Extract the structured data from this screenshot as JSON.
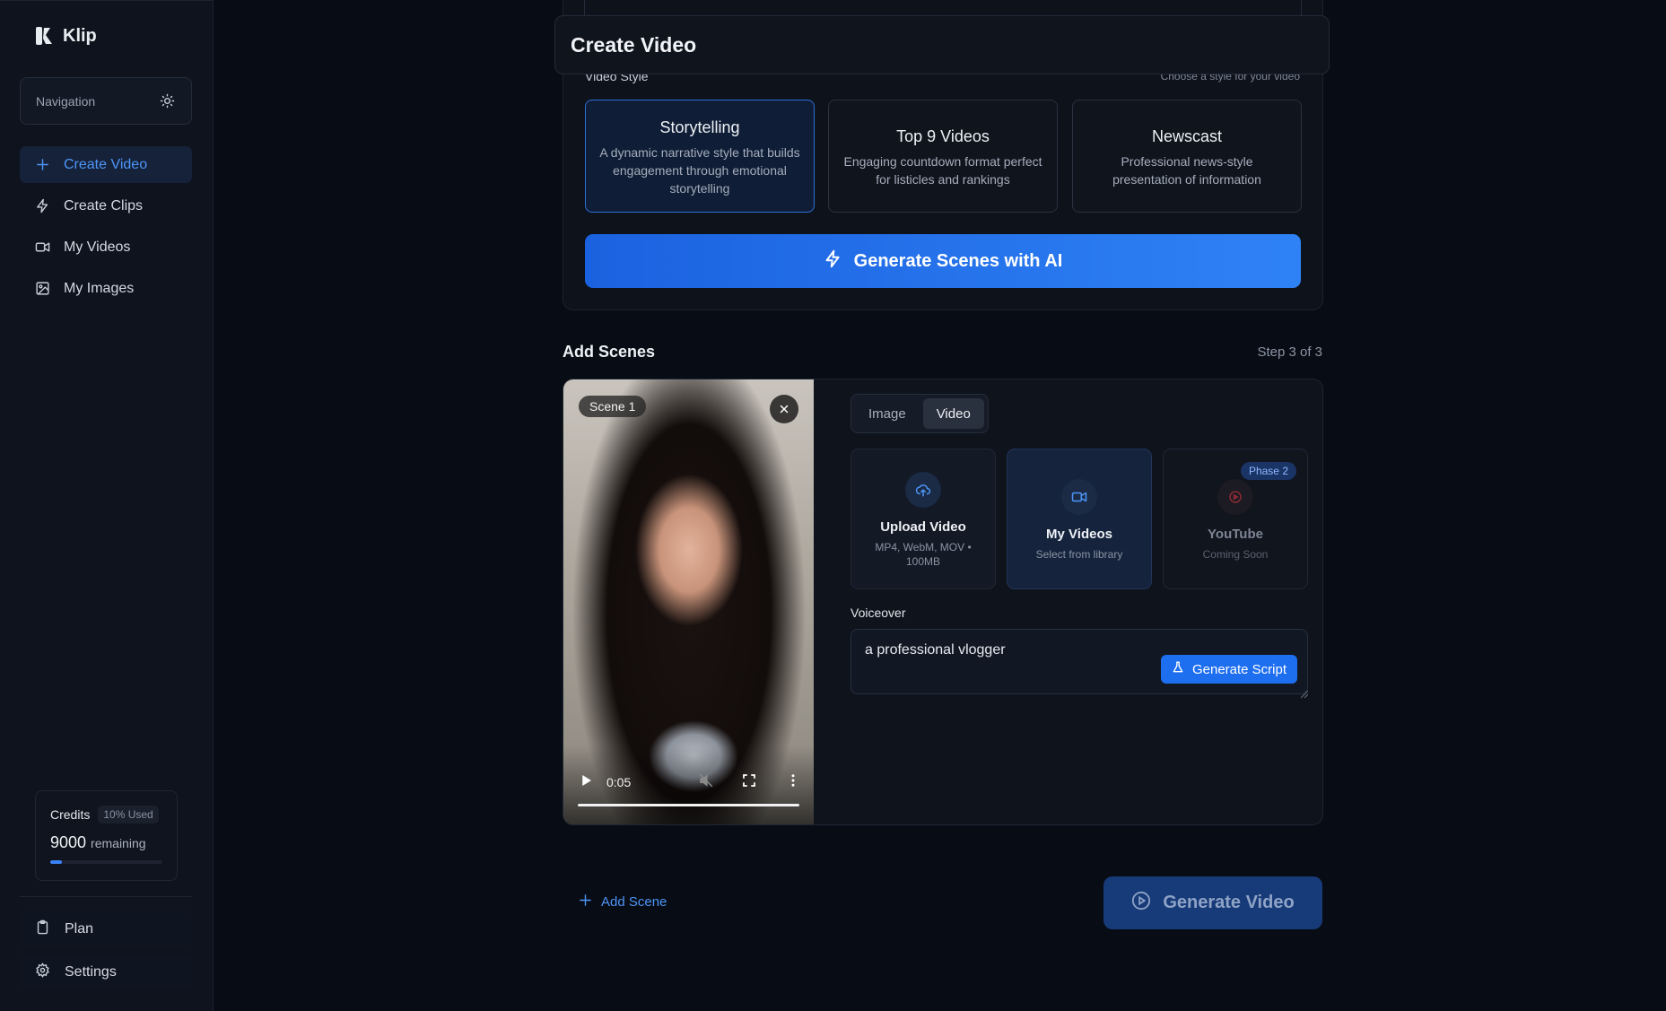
{
  "app": {
    "name": "Klip"
  },
  "sidebar": {
    "navigation_label": "Navigation",
    "items": [
      {
        "label": "Create Video",
        "icon": "plus-icon",
        "active": true
      },
      {
        "label": "Create Clips",
        "icon": "lightning-icon",
        "active": false
      },
      {
        "label": "My Videos",
        "icon": "video-camera-icon",
        "active": false
      },
      {
        "label": "My Images",
        "icon": "image-icon",
        "active": false
      }
    ],
    "credits": {
      "title": "Credits",
      "badge": "10% Used",
      "amount": "9000",
      "remaining_label": "remaining",
      "used_fraction": 0.1
    },
    "bottom": {
      "plan": "Plan",
      "settings": "Settings"
    }
  },
  "header": {
    "title": "Create Video"
  },
  "video_style": {
    "label": "Video Style",
    "hint": "Choose a style for your video",
    "options": [
      {
        "title": "Storytelling",
        "desc": "A dynamic narrative style that builds engagement through emotional storytelling",
        "selected": true
      },
      {
        "title": "Top 9 Videos",
        "desc": "Engaging countdown format perfect for listicles and rankings",
        "selected": false
      },
      {
        "title": "Newscast",
        "desc": "Professional news-style presentation of information",
        "selected": false
      }
    ],
    "generate_button": "Generate Scenes with AI"
  },
  "add_scenes": {
    "title": "Add Scenes",
    "step": "Step 3 of 3",
    "scene": {
      "tag": "Scene 1",
      "player": {
        "time": "0:05"
      },
      "tabs": [
        {
          "label": "Image",
          "active": false
        },
        {
          "label": "Video",
          "active": true
        }
      ],
      "sources": [
        {
          "title": "Upload Video",
          "sub": "MP4, WebM, MOV • 100MB",
          "icon": "upload-cloud-icon"
        },
        {
          "title": "My Videos",
          "sub": "Select from library",
          "icon": "video-camera-icon",
          "selected": true
        },
        {
          "title": "YouTube",
          "sub": "Coming Soon",
          "icon": "youtube-icon",
          "badge": "Phase 2",
          "disabled": true
        }
      ],
      "voiceover_label": "Voiceover",
      "voiceover_value": "a professional vlogger",
      "generate_script": "Generate Script"
    },
    "add_scene_button": "Add Scene",
    "generate_video_button": "Generate Video"
  },
  "colors": {
    "accent": "#3b82f6",
    "background": "#080c14",
    "sidebar": "#0e131d"
  }
}
